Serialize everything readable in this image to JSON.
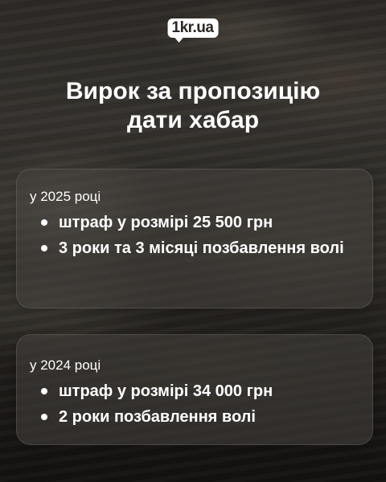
{
  "logo": {
    "text": "1kr.ua"
  },
  "title": {
    "line1": "Вирок за пропозицію",
    "line2": "дати хабар"
  },
  "cards": [
    {
      "year": "у 2025 році",
      "items": [
        "штраф у розмірі 25 500 грн",
        "3 роки та 3 місяці позбавлення волі"
      ]
    },
    {
      "year": "у 2024 році",
      "items": [
        "штраф у розмірі 34 000 грн",
        "2 роки позбавлення волі"
      ]
    }
  ]
}
